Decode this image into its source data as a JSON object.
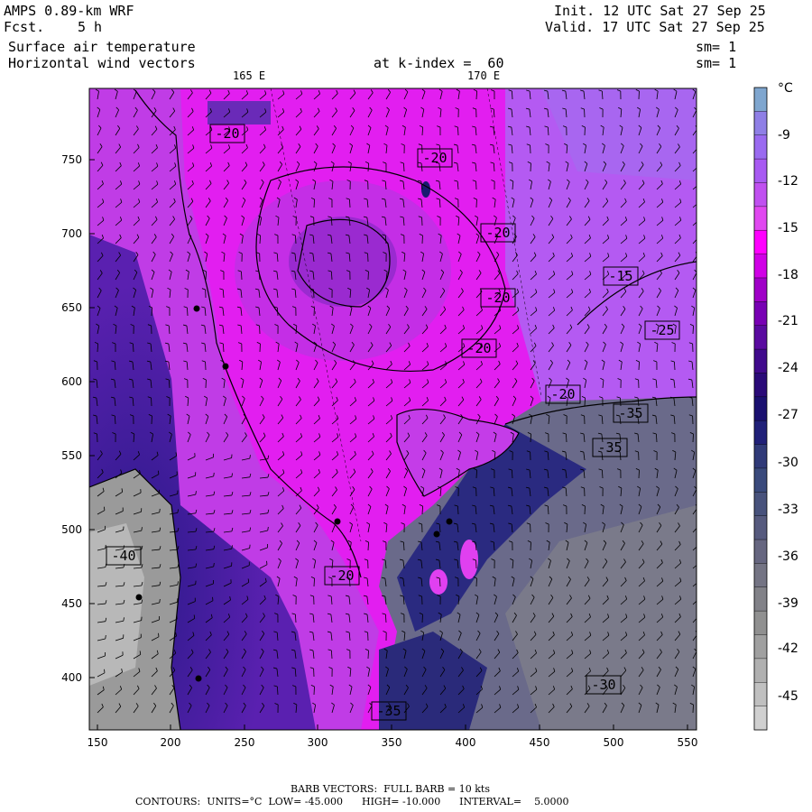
{
  "header": {
    "model": "AMPS 0.89-km WRF",
    "fcst_label": "Fcst.",
    "fcst_value": "5 h",
    "init": "Init. 12 UTC Sat 27 Sep 25",
    "valid": "Valid. 17 UTC Sat 27 Sep 25",
    "field1": "Surface air temperature",
    "field2": "Horizontal wind vectors",
    "level": "at k-index =  60",
    "sm1": "sm= 1",
    "sm2": "sm= 1"
  },
  "map": {
    "lon_labels": [
      "165 E",
      "170 E"
    ],
    "x_ticks": [
      "150",
      "200",
      "250",
      "300",
      "350",
      "400",
      "450",
      "500",
      "550"
    ],
    "y_ticks": [
      "750",
      "700",
      "650",
      "600",
      "550",
      "500",
      "450",
      "400"
    ],
    "contour_labels": [
      "-20",
      "-20",
      "-20",
      "-15",
      "-20",
      "-20",
      "-20",
      "-35",
      "-35",
      "-40",
      "-20",
      "-35",
      "-30",
      "-25"
    ],
    "contour_label_colors": {
      "line": "#000000"
    }
  },
  "colorbar": {
    "unit": "°C",
    "labels": [
      "-9",
      "-12",
      "-15",
      "-18",
      "-21",
      "-24",
      "-27",
      "-30",
      "-33",
      "-36",
      "-39",
      "-42",
      "-45"
    ],
    "colors": [
      "#7fa6cf",
      "#8f7fe6",
      "#9a6af0",
      "#a85af2",
      "#c050f0",
      "#e048f0",
      "#ff00ff",
      "#d000e6",
      "#a000c8",
      "#7800b4",
      "#5a0aa0",
      "#400a8c",
      "#2a0a78",
      "#1a1070",
      "#202078",
      "#303a78",
      "#3a4a7c",
      "#48527c",
      "#565a7e",
      "#666680",
      "#747484",
      "#828288",
      "#909090",
      "#a0a0a0",
      "#b0b0b0",
      "#c0c0c0",
      "#d0d0d0"
    ]
  },
  "footer": {
    "barb": "BARB VECTORS:  FULL BARB = 10 kts",
    "contours": "CONTOURS:  UNITS=°C  LOW= -45.000      HIGH= -10.000      INTERVAL=    5.0000"
  }
}
